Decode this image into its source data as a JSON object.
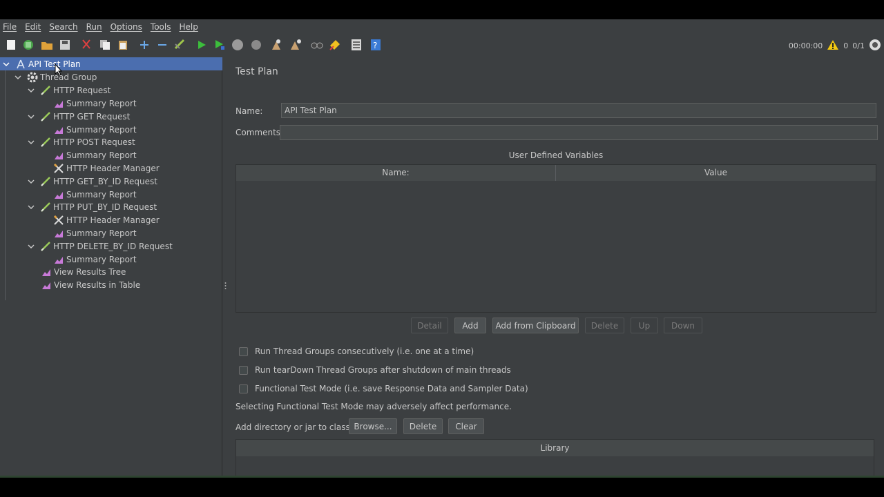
{
  "menu": [
    "File",
    "Edit",
    "Search",
    "Run",
    "Options",
    "Tools",
    "Help"
  ],
  "toolbar": {
    "icons": [
      "new-icon",
      "templates-icon",
      "open-icon",
      "save-icon",
      "cut-icon",
      "copy-icon",
      "paste-icon",
      "expand-icon",
      "collapse-icon",
      "toggle-icon",
      "start-icon",
      "start-no-pauses-icon",
      "stop-icon",
      "shutdown-icon",
      "clear-icon",
      "clear-all-icon",
      "search-icon",
      "reset-search-icon",
      "function-helper-icon",
      "help-icon"
    ],
    "timer": "00:00:00",
    "warnings": "0",
    "threads": "0/1"
  },
  "tree": {
    "nodes": [
      {
        "label": "API Test Plan",
        "icon": "test-plan-icon"
      },
      {
        "label": "Thread Group",
        "icon": "gear-icon"
      },
      {
        "label": "HTTP Request",
        "icon": "sampler-icon"
      },
      {
        "label": "Summary Report",
        "icon": "report-icon"
      },
      {
        "label": "HTTP GET Request",
        "icon": "sampler-icon"
      },
      {
        "label": "Summary Report",
        "icon": "report-icon"
      },
      {
        "label": "HTTP POST Request",
        "icon": "sampler-icon"
      },
      {
        "label": "Summary Report",
        "icon": "report-icon"
      },
      {
        "label": "HTTP Header Manager",
        "icon": "config-icon"
      },
      {
        "label": "HTTP GET_BY_ID Request",
        "icon": "sampler-icon"
      },
      {
        "label": "Summary Report",
        "icon": "report-icon"
      },
      {
        "label": "HTTP PUT_BY_ID Request",
        "icon": "sampler-icon"
      },
      {
        "label": "HTTP Header Manager",
        "icon": "config-icon"
      },
      {
        "label": "Summary Report",
        "icon": "report-icon"
      },
      {
        "label": "HTTP DELETE_BY_ID Request",
        "icon": "sampler-icon"
      },
      {
        "label": "Summary Report",
        "icon": "report-icon"
      },
      {
        "label": "View Results Tree",
        "icon": "report-icon"
      },
      {
        "label": "View Results in Table",
        "icon": "report-icon"
      }
    ]
  },
  "panel": {
    "title": "Test Plan",
    "name_label": "Name:",
    "name_value": "API Test Plan",
    "comments_label": "Comments:",
    "comments_value": "",
    "udv_title": "User Defined Variables",
    "udv_columns": [
      "Name:",
      "Value"
    ],
    "buttons": {
      "detail": "Detail",
      "add": "Add",
      "add_clipboard": "Add from Clipboard",
      "delete": "Delete",
      "up": "Up",
      "down": "Down"
    },
    "checkboxes": [
      "Run Thread Groups consecutively (i.e. one at a time)",
      "Run tearDown Thread Groups after shutdown of main threads",
      "Functional Test Mode (i.e. save Response Data and Sampler Data)"
    ],
    "functional_note": "Selecting Functional Test Mode may adversely affect performance.",
    "classpath_label": "Add directory or jar to classpath",
    "classpath_buttons": {
      "browse": "Browse...",
      "delete": "Delete",
      "clear": "Clear"
    },
    "library_header": "Library"
  },
  "colors": {
    "background": "#3c3f41",
    "selection": "#4b6eaf",
    "field": "#45494a"
  }
}
